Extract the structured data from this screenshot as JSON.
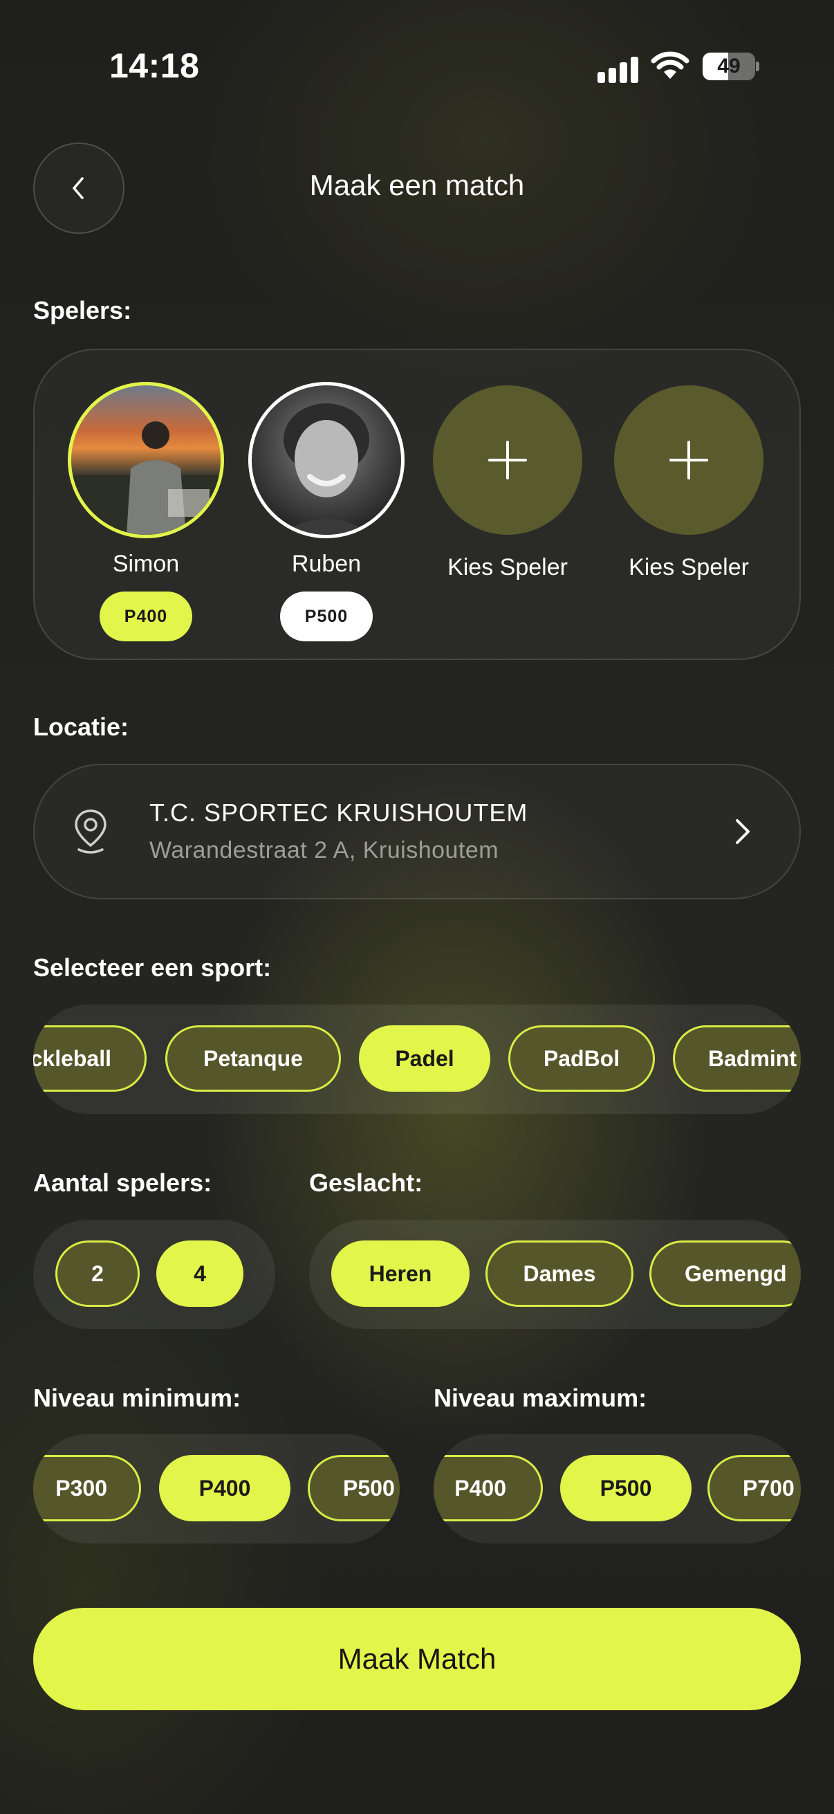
{
  "status_bar": {
    "time": "14:18",
    "battery": "49",
    "battery_level": 0.49
  },
  "header": {
    "title": "Maak een match",
    "back_icon": "chevron-left-icon"
  },
  "players": {
    "label": "Spelers:",
    "items": [
      {
        "name": "Simon",
        "level": "P400",
        "type": "selected"
      },
      {
        "name": "Ruben",
        "level": "P500",
        "type": "selected"
      },
      {
        "name": "Kies Speler",
        "type": "empty"
      },
      {
        "name": "Kies Speler",
        "type": "empty"
      }
    ]
  },
  "location": {
    "label": "Locatie:",
    "name": "T.C. SPORTEC KRUISHOUTEM",
    "address": "Warandestraat 2 A, Kruishoutem",
    "icon": "map-pin-icon",
    "chevron_icon": "chevron-right-icon"
  },
  "sport": {
    "label": "Selecteer een sport:",
    "options": [
      "Pickleball",
      "Petanque",
      "Padel",
      "PadBol",
      "Badminton"
    ],
    "visible_text": [
      "ckleball",
      "Petanque",
      "Padel",
      "PadBol",
      "Badmint"
    ],
    "selected": "Padel"
  },
  "player_count": {
    "label": "Aantal spelers:",
    "options": [
      "2",
      "4"
    ],
    "selected": "4"
  },
  "gender": {
    "label": "Geslacht:",
    "options": [
      "Heren",
      "Dames",
      "Gemengd"
    ],
    "selected": "Heren"
  },
  "level_min": {
    "label": "Niveau minimum:",
    "options": [
      "P300",
      "P400",
      "P500"
    ],
    "selected": "P400"
  },
  "level_max": {
    "label": "Niveau maximum:",
    "options": [
      "P400",
      "P500",
      "P700"
    ],
    "selected": "P500"
  },
  "cta": {
    "label": "Maak Match"
  },
  "colors": {
    "accent": "#e2f54a",
    "chip_inactive": "#55572b",
    "background": "#1e1e1c"
  }
}
